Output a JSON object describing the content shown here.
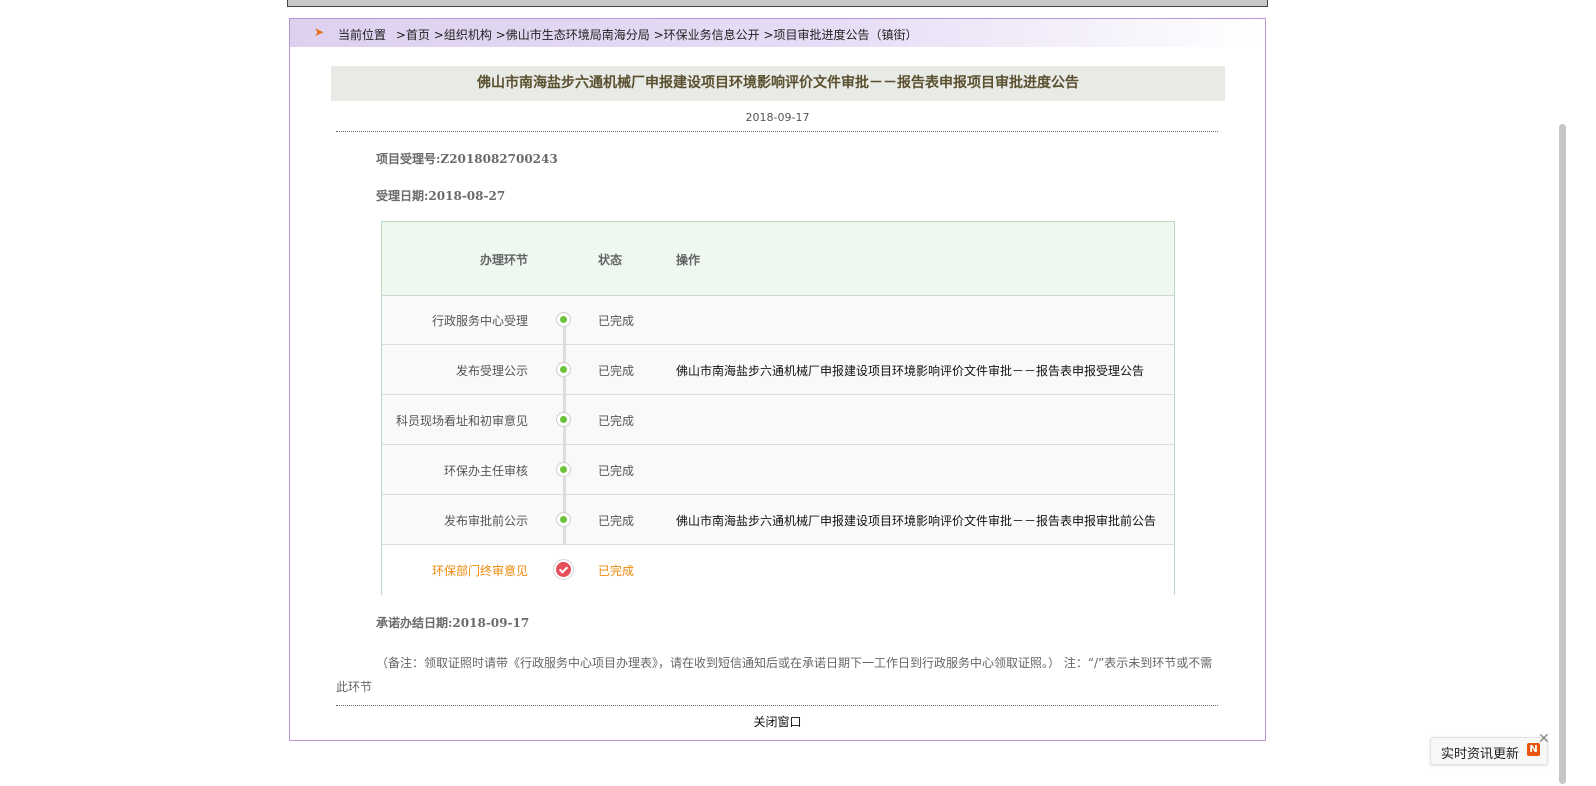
{
  "breadcrumb": {
    "prefix": "当前位置",
    "items": [
      "首页",
      "组织机构",
      "佛山市生态环境局南海分局",
      "环保业务信息公开",
      "项目审批进度公告（镇街）"
    ],
    "sep": ">"
  },
  "notice": {
    "title": "佛山市南海盐步六通机械厂申报建设项目环境影响评价文件审批－－报告表申报项目审批进度公告",
    "date": "2018-09-17",
    "accept_no": "项目受理号:Z2018082700243",
    "accept_date": "受理日期:2018-08-27",
    "promise_date": "承诺办结日期:2018-09-17",
    "note": "（备注：领取证照时请带《行政服务中心项目办理表》，请在收到短信通知后或在承诺日期下一工作日到行政服务中心领取证照。） 注：“/”表示未到环节或不需此环节",
    "close_label": "关闭窗口"
  },
  "table": {
    "headers": [
      "办理环节",
      "状态",
      "操作"
    ],
    "rows": [
      {
        "step": "行政服务中心受理",
        "status": "已完成",
        "action": ""
      },
      {
        "step": "发布受理公示",
        "status": "已完成",
        "action": "佛山市南海盐步六通机械厂申报建设项目环境影响评价文件审批－－报告表申报受理公告"
      },
      {
        "step": "科员现场看址和初审意见",
        "status": "已完成",
        "action": ""
      },
      {
        "step": "环保办主任审核",
        "status": "已完成",
        "action": ""
      },
      {
        "step": "发布审批前公示",
        "status": "已完成",
        "action": "佛山市南海盐步六通机械厂申报建设项目环境影响评价文件审批－－报告表申报审批前公告"
      },
      {
        "step": "环保部门终审意见",
        "status": "已完成",
        "action": ""
      }
    ]
  },
  "widget": {
    "label": "实时资讯更新",
    "badge": "N",
    "close": "✕"
  },
  "colors": {
    "frame_border": "#b896d8",
    "done_dot": "#6cc23a",
    "final_check": "#e84d5a",
    "final_text": "#ee8a0a"
  }
}
